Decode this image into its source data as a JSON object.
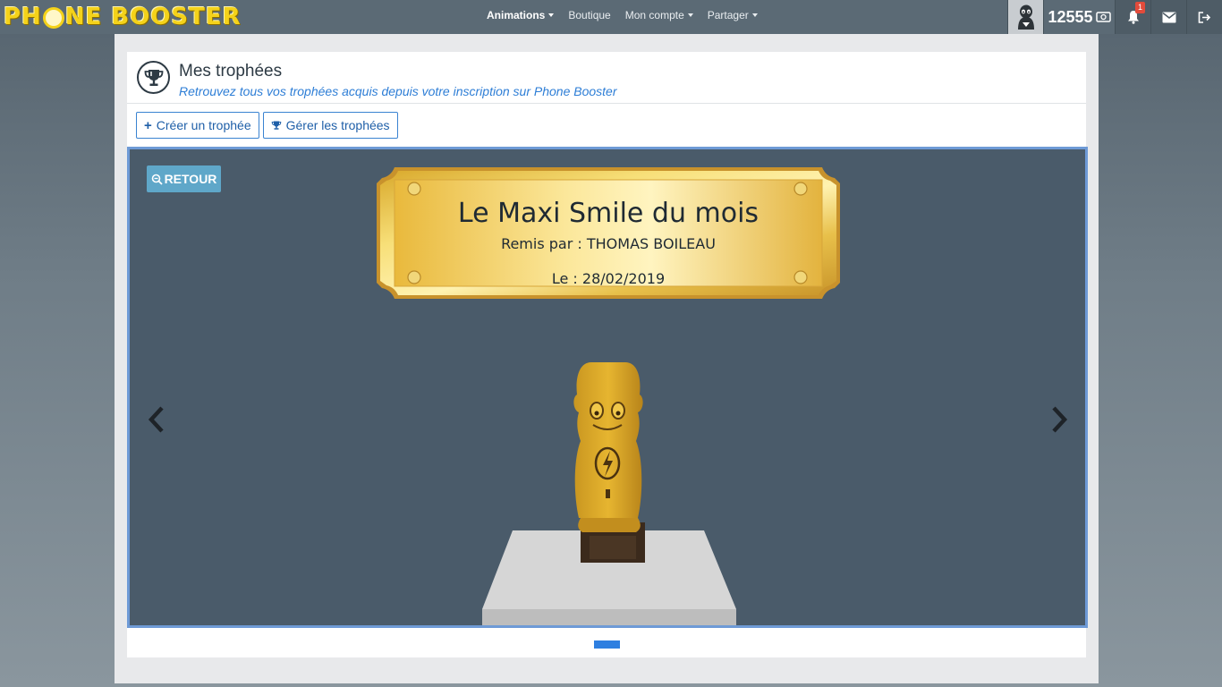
{
  "brand": {
    "logo_pre": "PH",
    "logo_post": "NE BOOSTER"
  },
  "nav": {
    "items": [
      {
        "label": "Animations",
        "active": true
      },
      {
        "label": "Boutique",
        "active": false
      },
      {
        "label": "Mon compte",
        "active": false
      },
      {
        "label": "Partager",
        "active": false
      }
    ],
    "points": "12555",
    "notifications_count": "1"
  },
  "page": {
    "title": "Mes trophées",
    "subtitle": "Retrouvez tous vos trophées acquis depuis votre inscription sur Phone Booster",
    "buttons": {
      "create": "Créer un trophée",
      "manage": "Gérer les trophées"
    }
  },
  "viewer": {
    "back_label": "RETOUR",
    "plaque": {
      "title": "Le Maxi Smile du mois",
      "awarded_by": "Remis par : THOMAS BOILEAU",
      "date": "Le : 28/02/2019"
    },
    "slide_index": 1
  },
  "colors": {
    "accent": "#2e7ed6",
    "stage_bg": "#4a5b6a",
    "plaque_gold": "#e9c23c",
    "logo_yellow": "#f4d21a"
  }
}
